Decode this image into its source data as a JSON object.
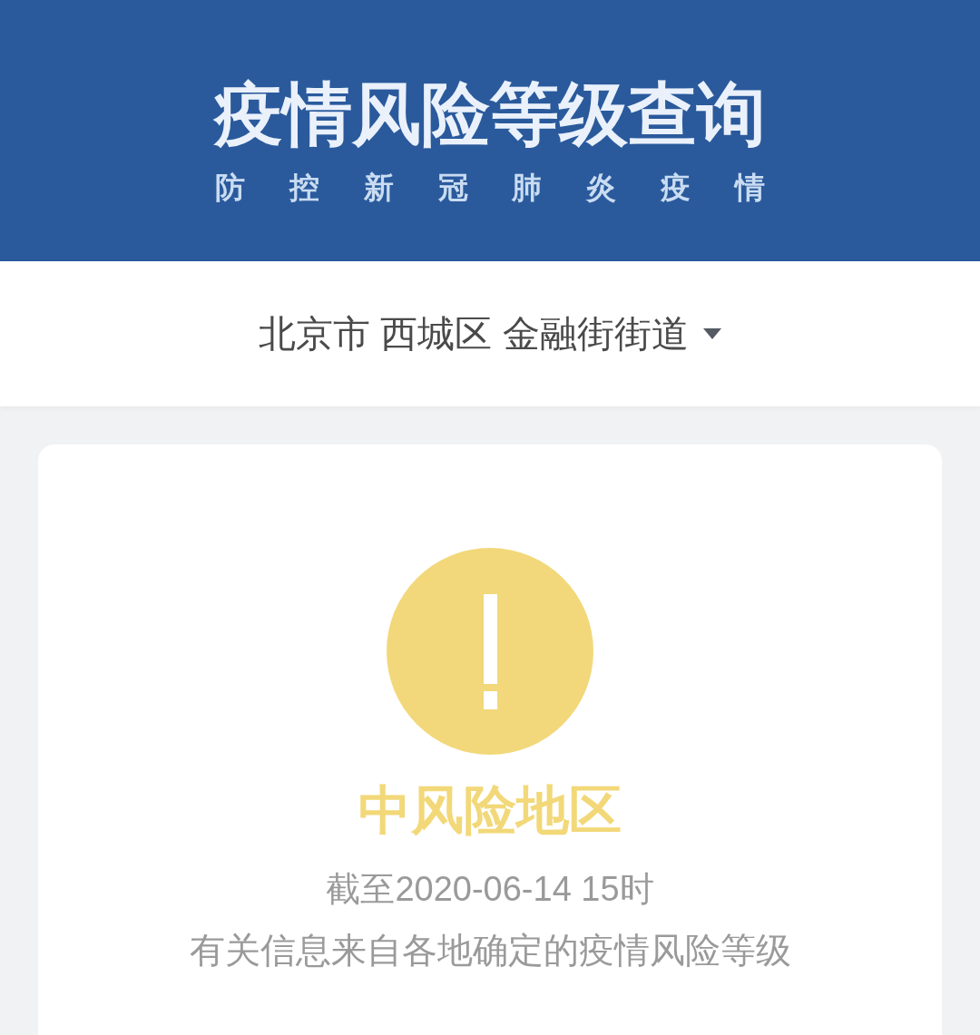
{
  "header": {
    "title": "疫情风险等级查询",
    "subtitle": "防 控 新 冠 肺 炎 疫 情"
  },
  "location": {
    "text": "北京市 西城区 金融街街道"
  },
  "result": {
    "risk_label": "中风险地区",
    "as_of": "截至2020-06-14 15时",
    "note": "有关信息来自各地确定的疫情风险等级"
  }
}
